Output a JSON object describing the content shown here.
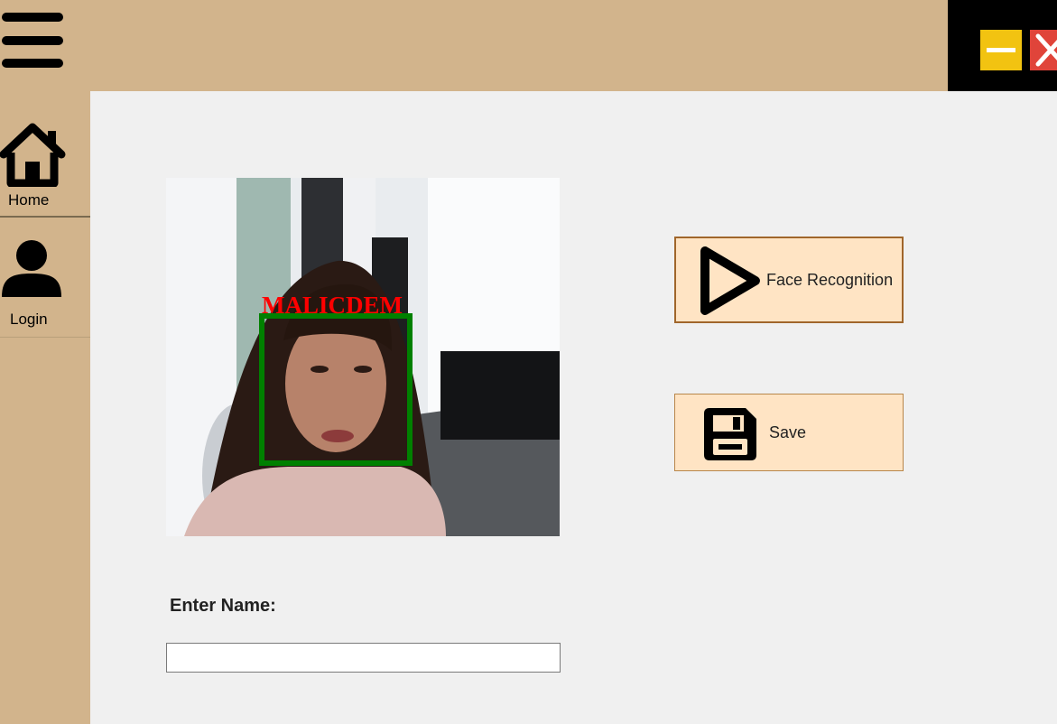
{
  "window": {
    "controls": {
      "minimize_icon": "minimize-icon",
      "close_icon": "close-icon",
      "minimize_color": "#f2c311",
      "close_color": "#e0443a"
    }
  },
  "header": {
    "menu_icon": "hamburger-menu-icon",
    "background": "#d2b48c"
  },
  "sidebar": {
    "items": [
      {
        "label": "Home",
        "icon": "home-icon"
      },
      {
        "label": "Login",
        "icon": "user-icon"
      }
    ]
  },
  "camera": {
    "detected_name": "MALICDEM",
    "box_color": "#008000",
    "label_color": "#ff0000"
  },
  "actions": {
    "face_recognition": {
      "label": "Face Recognition",
      "icon": "play-icon"
    },
    "save": {
      "label": "Save",
      "icon": "floppy-disk-icon"
    }
  },
  "form": {
    "name_label": "Enter Name:",
    "name_value": "",
    "name_placeholder": ""
  }
}
